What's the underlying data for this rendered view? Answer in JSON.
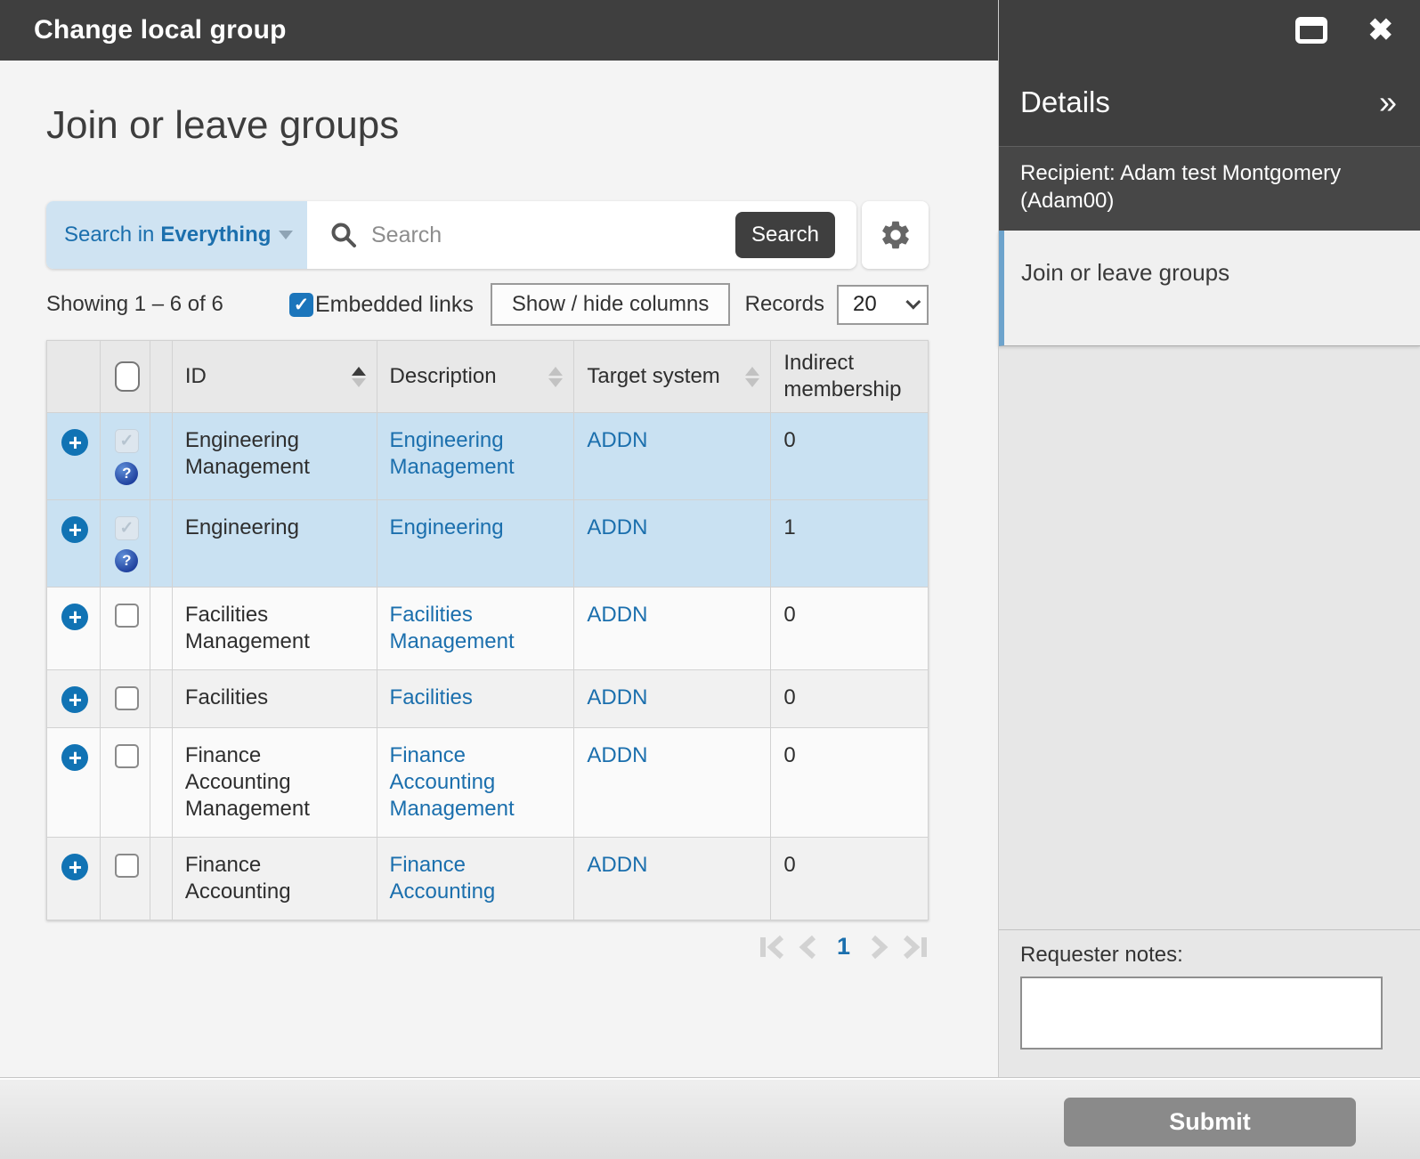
{
  "window": {
    "title": "Change local group"
  },
  "main": {
    "heading": "Join or leave groups",
    "search": {
      "filter_label": "Search in",
      "filter_value": "Everything",
      "placeholder": "Search",
      "button_label": "Search"
    },
    "controls": {
      "showing": "Showing 1 – 6 of 6",
      "embedded_links_label": "Embedded links",
      "embedded_links_checked": true,
      "show_hide_label": "Show / hide columns",
      "records_label": "Records",
      "records_value": "20"
    },
    "table": {
      "columns": [
        "ID",
        "Description",
        "Target system",
        "Indirect membership"
      ],
      "sort": {
        "column": "ID",
        "direction": "ascending"
      },
      "rows": [
        {
          "id": "Engineering Management",
          "description": "Engineering Management",
          "target": "ADDN",
          "indirect": "0",
          "selected": true,
          "indirect_link": false
        },
        {
          "id": "Engineering",
          "description": "Engineering",
          "target": "ADDN",
          "indirect": "1",
          "selected": true,
          "indirect_link": true
        },
        {
          "id": "Facilities Management",
          "description": "Facilities Management",
          "target": "ADDN",
          "indirect": "0",
          "selected": false,
          "indirect_link": false
        },
        {
          "id": "Facilities",
          "description": "Facilities",
          "target": "ADDN",
          "indirect": "0",
          "selected": false,
          "indirect_link": false
        },
        {
          "id": "Finance Accounting Management",
          "description": "Finance Accounting Management",
          "target": "ADDN",
          "indirect": "0",
          "selected": false,
          "indirect_link": false
        },
        {
          "id": "Finance Accounting",
          "description": "Finance Accounting",
          "target": "ADDN",
          "indirect": "0",
          "selected": false,
          "indirect_link": false
        }
      ]
    },
    "pagination": {
      "current_page": "1"
    }
  },
  "details": {
    "title": "Details",
    "recipient": "Recipient: Adam test Montgomery (Adam00)",
    "item_label": "Join or leave groups",
    "requester_notes_label": "Requester notes:",
    "requester_notes_value": "",
    "submit_label": "Submit"
  },
  "icons": {
    "titlebar": [
      "maximize-icon",
      "close-icon"
    ],
    "search": [
      "search-icon",
      "gear-icon"
    ],
    "rows": [
      "plus-circle-icon",
      "question-circle-icon"
    ],
    "pagination": [
      "first-page-icon",
      "prev-page-icon",
      "next-page-icon",
      "last-page-icon"
    ],
    "panel": [
      "double-chevron-right-icon"
    ]
  },
  "colors": {
    "titlebar_bg": "#3f3f3f",
    "accent_blue": "#1b6fad",
    "filter_bg": "#cfe3f2",
    "selected_row_bg": "#c9e1f2",
    "panel_bg": "#e7e7e7",
    "panel_item_border": "#6da3cc",
    "submit_bg": "#8a8a8a",
    "checkbox_blue": "#1b75bb"
  }
}
